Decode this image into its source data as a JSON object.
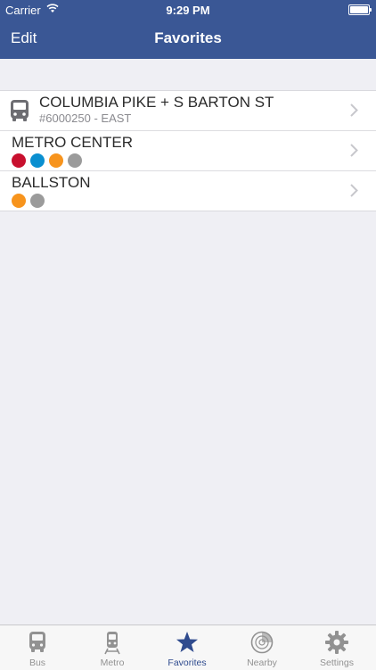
{
  "status": {
    "carrier": "Carrier",
    "time": "9:29 PM"
  },
  "nav": {
    "edit_label": "Edit",
    "title": "Favorites"
  },
  "favorites": [
    {
      "title": "COLUMBIA PIKE + S BARTON ST",
      "subtitle": "#6000250 - EAST",
      "icon": "bus-icon"
    },
    {
      "title": "METRO CENTER",
      "line_colors": [
        "#c8102e",
        "#0a8fd0",
        "#f7941d",
        "#9b9b9b"
      ]
    },
    {
      "title": "BALLSTON",
      "line_colors": [
        "#f7941d",
        "#9b9b9b"
      ]
    }
  ],
  "tabs": [
    {
      "label": "Bus",
      "icon": "bus-icon"
    },
    {
      "label": "Metro",
      "icon": "train-icon"
    },
    {
      "label": "Favorites",
      "icon": "star-icon",
      "active": true
    },
    {
      "label": "Nearby",
      "icon": "radar-icon"
    },
    {
      "label": "Settings",
      "icon": "gear-icon"
    }
  ],
  "colors": {
    "header": "#3a5795",
    "active_tab": "#2f4b8e",
    "inactive_tab": "#929292"
  }
}
